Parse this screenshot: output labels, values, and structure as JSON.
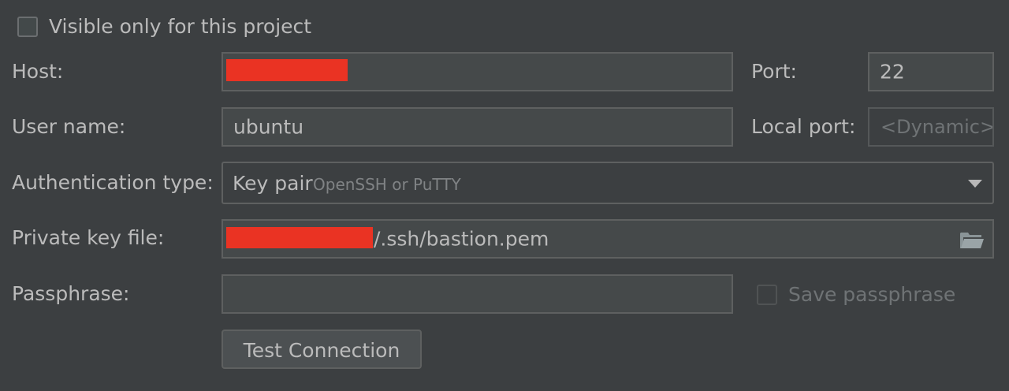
{
  "visible_only_checkbox": {
    "label": "Visible only for this project",
    "checked": false
  },
  "host": {
    "label": "Host:",
    "value": "",
    "redacted": true
  },
  "port": {
    "label": "Port:",
    "value": "22"
  },
  "user_name": {
    "label": "User name:",
    "value": "ubuntu"
  },
  "local_port": {
    "label": "Local port:",
    "placeholder": "<Dynamic>"
  },
  "auth_type": {
    "label": "Authentication type:",
    "value": "Key pair",
    "hint": "OpenSSH or PuTTY",
    "icon": "chevron-down-icon"
  },
  "private_key": {
    "label": "Private key file:",
    "value_suffix": "/.ssh/bastion.pem",
    "redacted_prefix": true,
    "icon": "folder-open-icon"
  },
  "passphrase": {
    "label": "Passphrase:",
    "value": ""
  },
  "save_passphrase": {
    "label": "Save passphrase",
    "checked": false,
    "enabled": false
  },
  "test_connection": {
    "label": "Test Connection"
  },
  "colors": {
    "background": "#3c3f41",
    "text": "#bbbbbb",
    "field_background": "#45494a",
    "field_border": "#5e6060",
    "redaction": "#ea3323"
  }
}
